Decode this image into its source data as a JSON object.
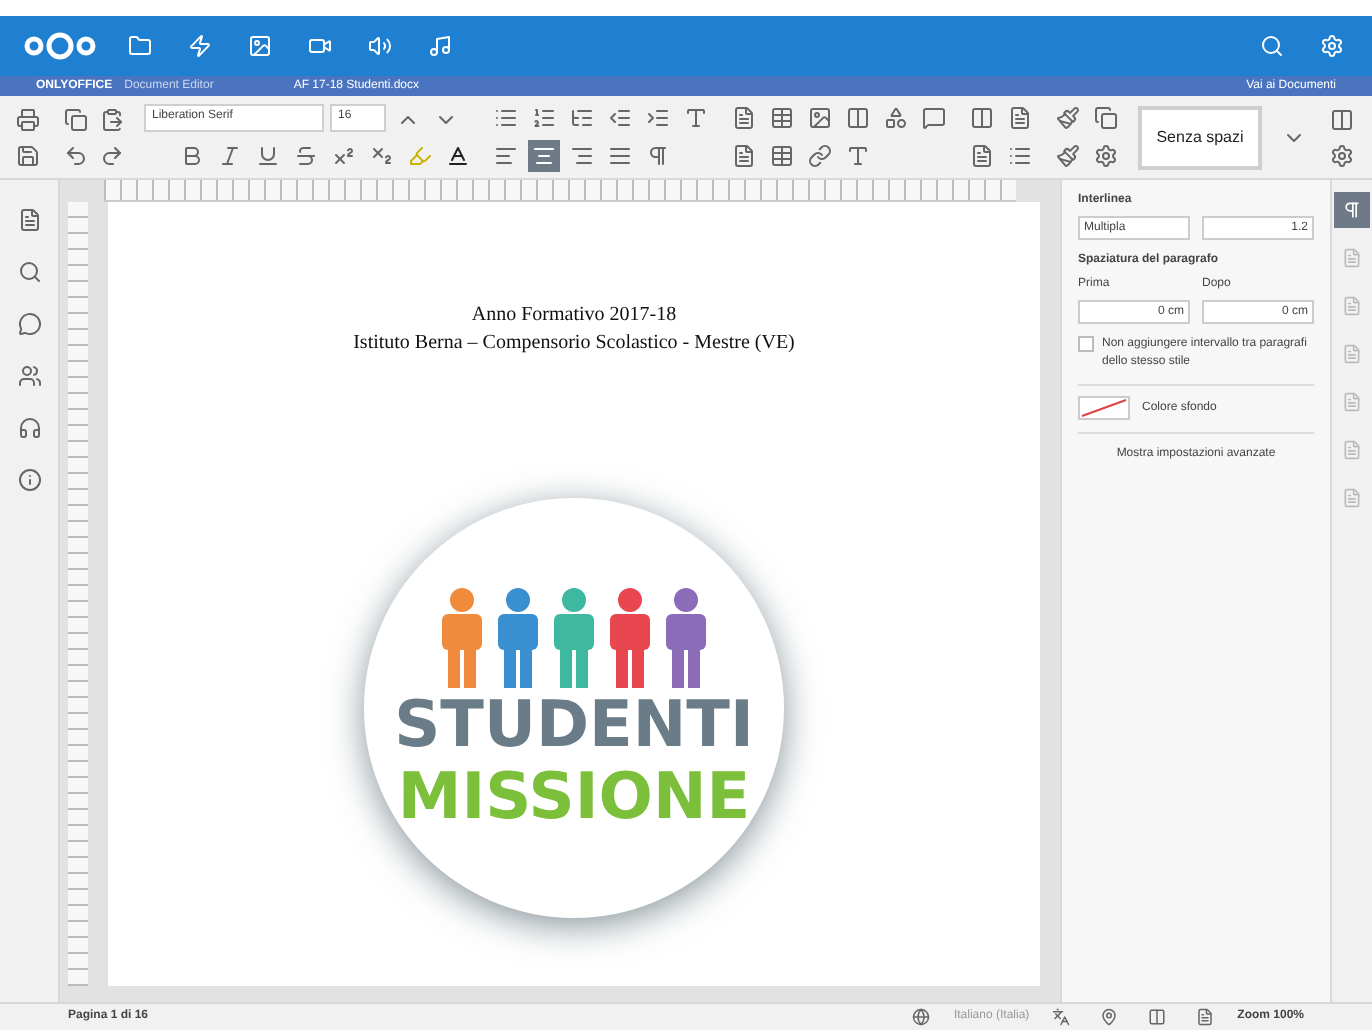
{
  "header": {
    "app_name": "ONLYOFFICE",
    "app_subtitle": "Document Editor",
    "doc_title": "AF 17-18 Studenti.docx",
    "link": "Vai ai Documenti"
  },
  "toolbar": {
    "font": "Liberation Serif",
    "size": "16",
    "style": "Senza spazi"
  },
  "document": {
    "lines": [
      "Anno Formativo 2017-18",
      "Istituto Berna – Compensorio Scolastico - Mestre (VE)"
    ],
    "logo": {
      "line1": "STUDENTI",
      "line2": "MISSIONE",
      "figures": [
        {
          "color": "#f08a3c"
        },
        {
          "color": "#3a8fd0"
        },
        {
          "color": "#3fb8a0"
        },
        {
          "color": "#e8474f"
        },
        {
          "color": "#8c6bb8"
        }
      ]
    }
  },
  "panel": {
    "spacing_label": "Interlinea",
    "spacing_mode": "Multipla",
    "spacing_value": "1.2",
    "paragraph_label": "Spaziatura del paragrafo",
    "before_label": "Prima",
    "after_label": "Dopo",
    "before_value": "0 cm",
    "after_value": "0 cm",
    "checkbox": {
      "label": "Non aggiungere intervallo tra paragrafi dello stesso stile",
      "checked": false
    },
    "background_label": "Colore sfondo",
    "advanced_link": "Mostra impostazioni avanzate"
  },
  "right_tabs": [
    {
      "selected": true
    },
    {
      "selected": false
    },
    {
      "selected": false
    },
    {
      "selected": false
    },
    {
      "selected": false
    },
    {
      "selected": false
    },
    {
      "selected": false
    }
  ],
  "status_bar": {
    "page": "Pagina 1 di 16",
    "language": "Italiano (Italia)",
    "zoom": "Zoom 100%"
  }
}
